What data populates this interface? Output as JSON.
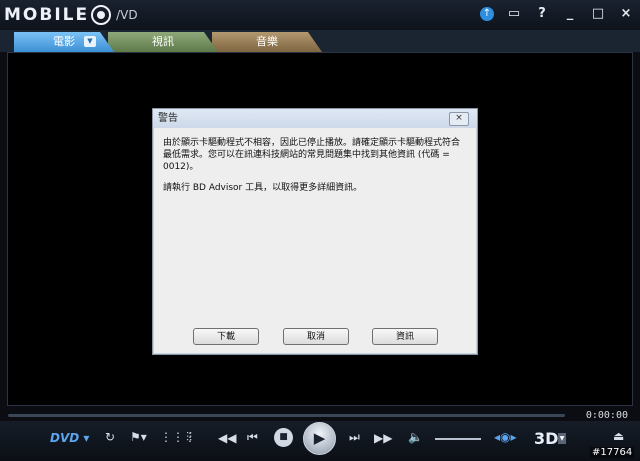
{
  "window": {
    "logo_text": "MOBILE",
    "logo_suffix": "/VD",
    "buttons": {
      "update": "↑",
      "tv": "📺",
      "help": "?",
      "minimize": "_",
      "maximize": "□",
      "close": "×"
    }
  },
  "tabs": [
    {
      "label": "電影"
    },
    {
      "label": "視訊"
    },
    {
      "label": "音樂"
    }
  ],
  "dialog": {
    "title": "警告",
    "close": "×",
    "message": "由於顯示卡驅動程式不相容，因此已停止播放。請確定顯示卡驅動程式符合最低需求。您可以在訊連科技網站的常見問題集中找到其他資訊 (代碼 = 0012)。",
    "advisor": "請執行 BD Advisor 工具，以取得更多詳細資訊。",
    "buttons": {
      "download": "下載",
      "cancel": "取消",
      "info": "資訊"
    }
  },
  "player": {
    "time": "0:00:00",
    "source": "DVD ▾",
    "label_3d": "3D",
    "progress": 0
  },
  "watermark": "#17764",
  "colors": {
    "accent": "#3c8fd6",
    "background": "#000000"
  }
}
